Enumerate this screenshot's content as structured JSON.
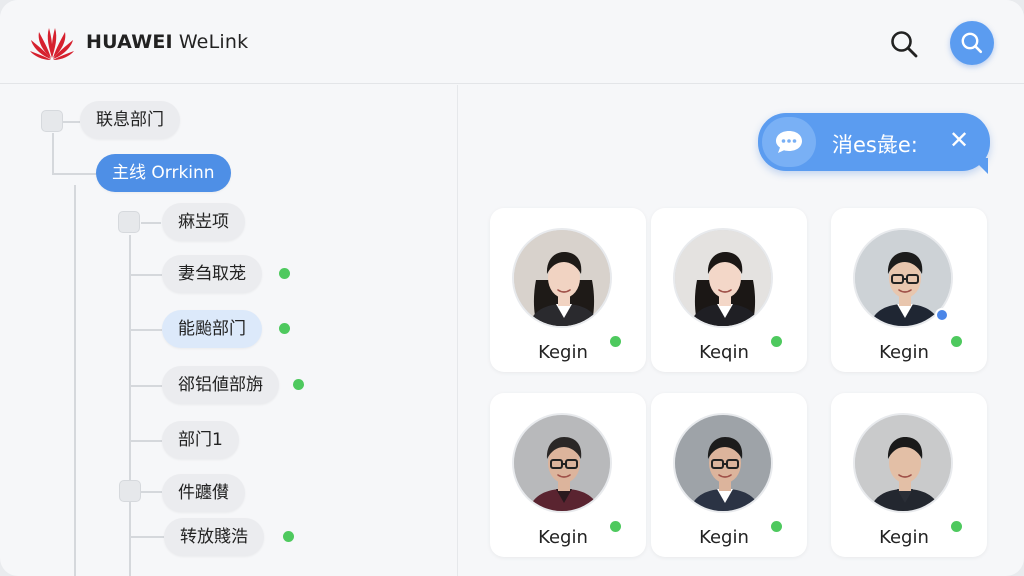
{
  "header": {
    "brand": "HUAWEI",
    "app_name": "WeLink",
    "search_icon": "search-icon",
    "search_button_icon": "search-icon"
  },
  "tree": {
    "root": {
      "label": "联息部门"
    },
    "selected": {
      "label": "主线 Orrkinn"
    },
    "items": [
      {
        "label": "痳岦项",
        "online": false
      },
      {
        "label": "妻刍取茏",
        "online": true
      },
      {
        "label": "能颱部门",
        "online": true
      },
      {
        "label": "郤铝値部旃",
        "online": true
      },
      {
        "label": "部门1",
        "online": false
      },
      {
        "label": "件躔儧",
        "online": false
      },
      {
        "label": "转放賤浩",
        "online": true
      }
    ]
  },
  "message": {
    "icon": "chat-bubble-icon",
    "text": "消es彘e:",
    "close": "✕"
  },
  "contacts": [
    {
      "name": "Kegin",
      "online": true
    },
    {
      "name": "Keqin",
      "online": true
    },
    {
      "name": "Kegin",
      "online": true,
      "badge": "blue"
    },
    {
      "name": "Kegin",
      "online": true
    },
    {
      "name": "Kegin",
      "online": true
    },
    {
      "name": "Kegin",
      "online": true
    }
  ],
  "colors": {
    "accent": "#5b9cf0",
    "online": "#4ec95e",
    "logo": "#d6202e"
  }
}
